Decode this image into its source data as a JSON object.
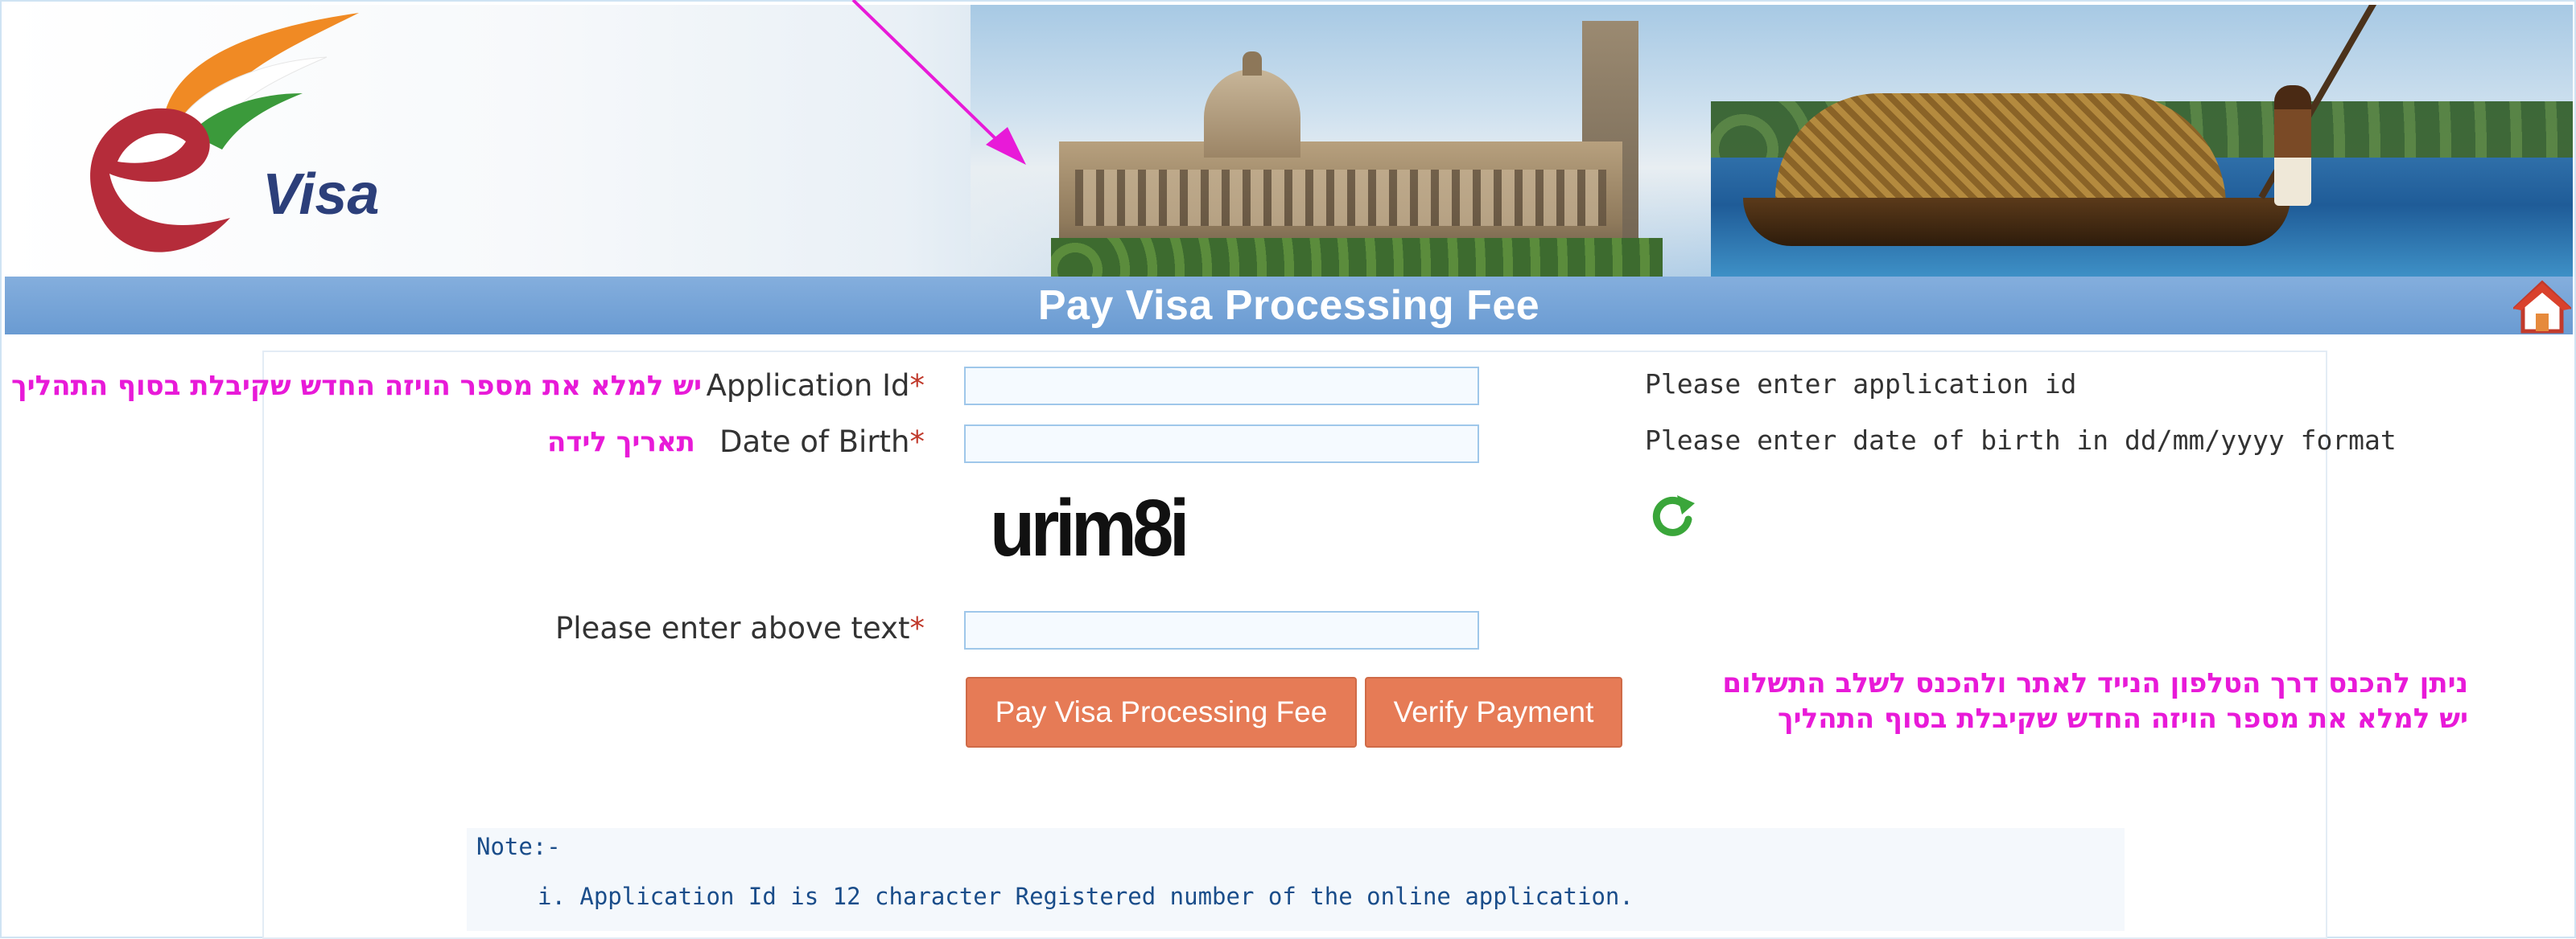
{
  "header": {
    "logo_text": "Visa",
    "title": "Pay Visa Processing Fee"
  },
  "form": {
    "application_id": {
      "label": "Application Id",
      "required_mark": "*",
      "value": "",
      "hint": "Please enter application id"
    },
    "dob": {
      "label": "Date of Birth",
      "required_mark": "*",
      "value": "",
      "hint": "Please enter date of birth in dd/mm/yyyy format"
    },
    "captcha": {
      "image_text": "urim8i",
      "label": "Please enter above text",
      "required_mark": "*",
      "value": ""
    },
    "buttons": {
      "pay": "Pay Visa Processing Fee",
      "verify": "Verify Payment"
    }
  },
  "note": {
    "title": "Note:-",
    "items": [
      "i. Application Id is 12 character Registered number of the online application."
    ]
  },
  "annotations": {
    "app_id": "יש למלא את מספר הויזה החדש שקיבלת בסוף התהליך",
    "dob": "תאריך לידה",
    "mobile_line1": "ניתן להכנס דרך הטלפון הנייד לאתר ולהכנס לשלב התשלום",
    "mobile_line2": "יש למלא את מספר הויזה החדש שקיבלת בסוף התהליך"
  },
  "colors": {
    "title_bar": "#6a9bd2",
    "button": "#e67b56",
    "annotation": "#e81ad8",
    "refresh": "#3aa63a"
  },
  "icons": [
    "home-icon",
    "refresh-icon",
    "evisa-logo"
  ]
}
